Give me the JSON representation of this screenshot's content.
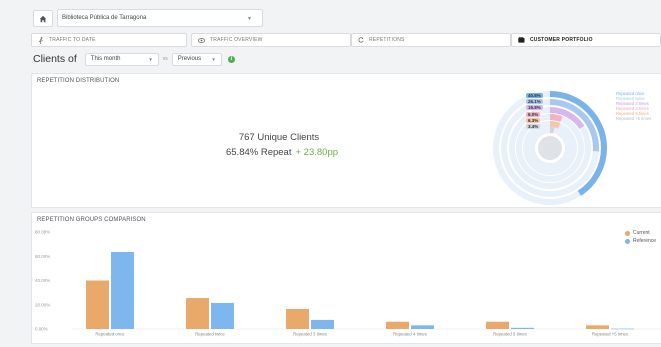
{
  "header": {
    "library_label": "Biblioteca Pública de Tarragona"
  },
  "tabs": [
    {
      "label": "TRAFFIC TO DATE",
      "icon": "walking-person-icon"
    },
    {
      "label": "TRAFFIC OVERVIEW",
      "icon": "eye-icon"
    },
    {
      "label": "REPETITIONS",
      "icon": "refresh-icon"
    },
    {
      "label": "CUSTOMER PORTFOLIO",
      "icon": "wallet-icon"
    }
  ],
  "filters": {
    "title": "Clients of",
    "period": "This month",
    "vs_label": "vs",
    "compare_period": "Previous"
  },
  "distribution": {
    "title": "REPETITION DISTRIBUTION",
    "unique_clients": "767 Unique Clients",
    "repeat_rate": "65.84% Repeat",
    "repeat_delta": "+ 23.80pp",
    "ring_labels": [
      "40.8%",
      "26.1%",
      "15.8%",
      "6.0%",
      "6.3%",
      "3.4%"
    ],
    "ring_colors": [
      "#7ab3ea",
      "#a9c8ef",
      "#d6b8ec",
      "#f2b3c6",
      "#f6c7a6",
      "#cfd6de"
    ],
    "legend": [
      "Repeated once",
      "Repeated twice",
      "Repeated 3 times",
      "Repeated 4 times",
      "Repeated 5 times",
      "Repeated +5 times"
    ]
  },
  "comparison": {
    "title": "REPETITION GROUPS COMPARISON",
    "legend": [
      "Current",
      "Reference"
    ],
    "colors": {
      "current": "#e9a96a",
      "reference": "#7eb6ee"
    }
  },
  "chart_data": {
    "type": "bar",
    "title": "REPETITION GROUPS COMPARISON",
    "categories": [
      "Repeated once",
      "Repeated twice",
      "Repeated 3 times",
      "Repeated 4 times",
      "Repeated 5 times",
      "Repeated +5 times"
    ],
    "series": [
      {
        "name": "Current",
        "values": [
          40.0,
          25.5,
          16.5,
          6.0,
          6.0,
          3.0
        ]
      },
      {
        "name": "Reference",
        "values": [
          63.5,
          21.5,
          7.5,
          3.0,
          1.0,
          0.3
        ]
      }
    ],
    "ylim": [
      0,
      80
    ],
    "yticks": [
      "0.00%",
      "20.00%",
      "40.00%",
      "60.00%",
      "80.00%"
    ],
    "legend_position": "top-right",
    "grid": false
  }
}
